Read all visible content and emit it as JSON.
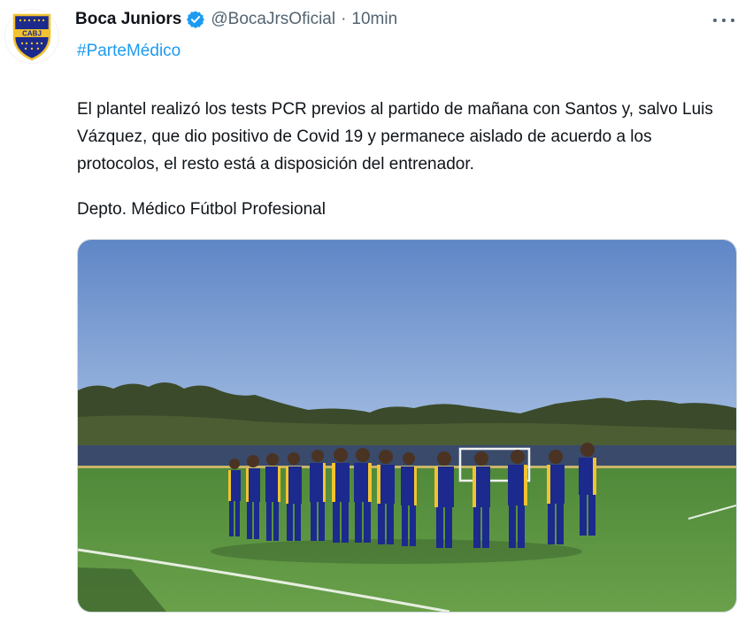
{
  "tweet": {
    "author": {
      "display_name": "Boca Juniors",
      "handle": "@BocaJrsOficial",
      "avatar_text": "CABJ",
      "verified": true
    },
    "time": "10min",
    "separator": "·",
    "hashtag": "#ParteMédico",
    "body": "El plantel realizó los tests PCR previos al partido de mañana con Santos y, salvo Luis Vázquez, que dio positivo de Covid 19 y permanece aislado de acuerdo a los protocolos, el resto está a disposición del entrenador.",
    "signature": "Depto. Médico Fútbol Profesional",
    "more_icon": "more-horizontal-icon",
    "verified_icon": "verified-badge-icon"
  },
  "colors": {
    "link": "#1d9bf0",
    "verified": "#1d9bf0",
    "text": "#0f1419",
    "muted": "#536471",
    "boca_blue": "#1b2a8c",
    "boca_gold": "#f2c230"
  }
}
